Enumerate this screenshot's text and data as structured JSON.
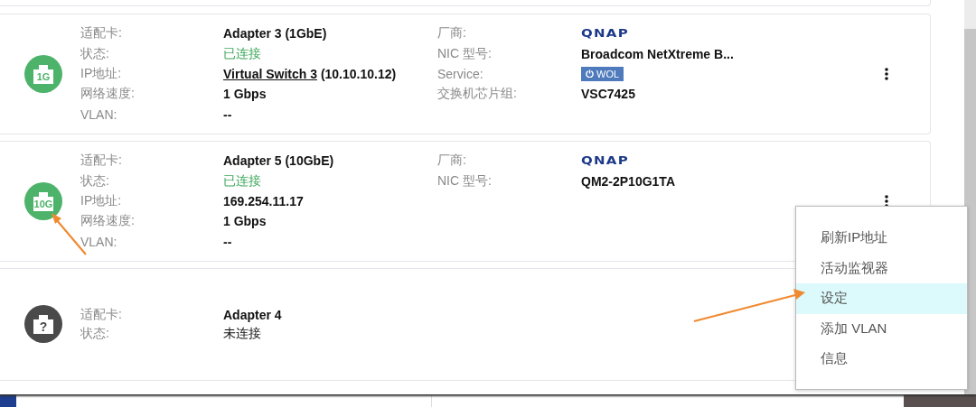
{
  "adapters": [
    {
      "connected": true,
      "badge": "1G",
      "menu_button": true,
      "left": [
        {
          "label": "适配卡:",
          "kind": "text",
          "value": "Adapter 3 (1GbE)"
        },
        {
          "label": "状态:",
          "kind": "status",
          "value": "已连接"
        },
        {
          "label": "IP地址:",
          "kind": "link",
          "link": "Virtual Switch 3",
          "value": " (10.10.10.12)"
        },
        {
          "label": "网络速度:",
          "kind": "text",
          "value": "1 Gbps"
        },
        {
          "label": "VLAN:",
          "kind": "text",
          "value": "--"
        }
      ],
      "right": [
        {
          "label": "厂商:",
          "kind": "logo",
          "value": "QNAP"
        },
        {
          "label": "NIC 型号:",
          "kind": "text",
          "value": "Broadcom NetXtreme B..."
        },
        {
          "label": "Service:",
          "kind": "badge",
          "value": "WOL"
        },
        {
          "label": "交换机芯片组:",
          "kind": "text",
          "value": "VSC7425"
        }
      ]
    },
    {
      "connected": true,
      "badge": "10G",
      "menu_button": true,
      "left": [
        {
          "label": "适配卡:",
          "kind": "text",
          "value": "Adapter 5 (10GbE)"
        },
        {
          "label": "状态:",
          "kind": "status",
          "value": "已连接"
        },
        {
          "label": "IP地址:",
          "kind": "text",
          "value": "169.254.11.17"
        },
        {
          "label": "网络速度:",
          "kind": "text",
          "value": "1 Gbps"
        },
        {
          "label": "VLAN:",
          "kind": "text",
          "value": "--"
        }
      ],
      "right": [
        {
          "label": "厂商:",
          "kind": "logo",
          "value": "QNAP"
        },
        {
          "label": "NIC 型号:",
          "kind": "text",
          "value": "QM2-2P10G1TA"
        }
      ]
    },
    {
      "connected": false,
      "badge": "?",
      "menu_button": false,
      "left": [
        {
          "label": "适配卡:",
          "kind": "text",
          "value": "Adapter 4"
        },
        {
          "label": "状态:",
          "kind": "status",
          "value": "未连接"
        }
      ]
    }
  ],
  "context_menu": [
    {
      "label": "刷新IP地址",
      "selected": false
    },
    {
      "label": "活动监视器",
      "selected": false
    },
    {
      "label": "设定",
      "selected": true
    },
    {
      "label": "添加 VLAN",
      "selected": false
    },
    {
      "label": "信息",
      "selected": false
    }
  ]
}
